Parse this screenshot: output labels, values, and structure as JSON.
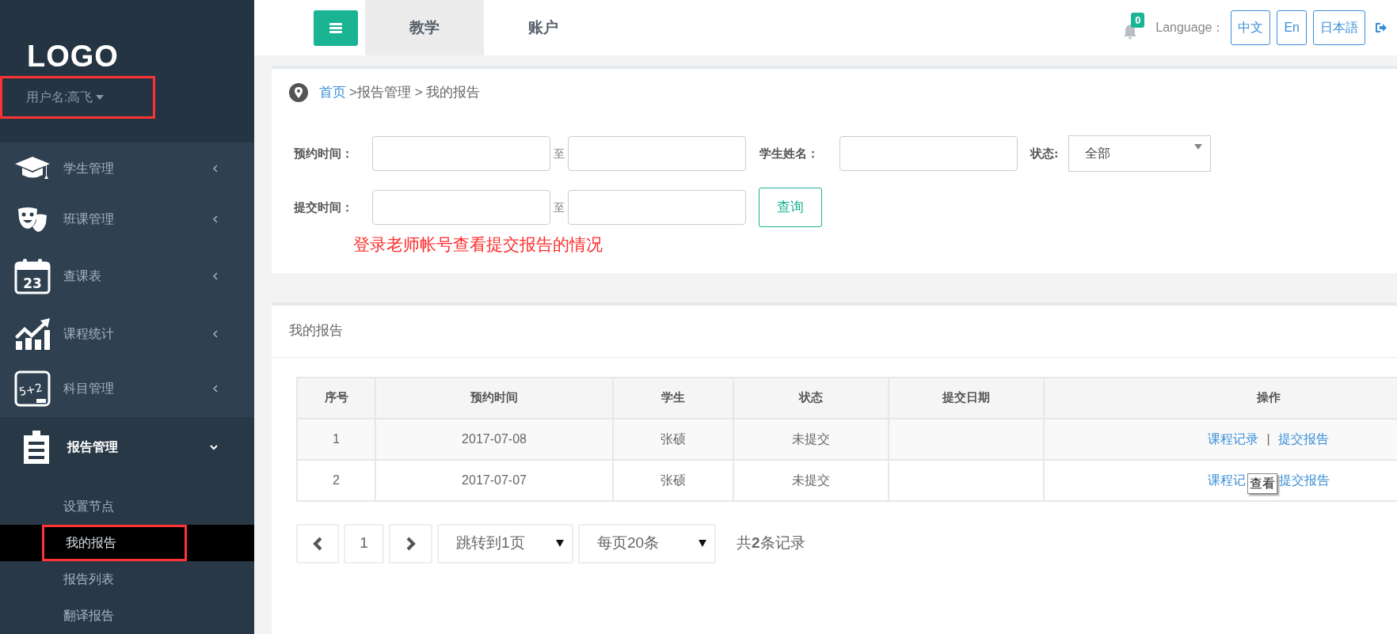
{
  "sidebar": {
    "logo": "LOGO",
    "user": "用户名:高飞",
    "user_annotated": true,
    "items": [
      {
        "label": "学生管理",
        "expanded": false
      },
      {
        "label": "班课管理",
        "expanded": false
      },
      {
        "label": "查课表",
        "expanded": false,
        "icon_text": "23"
      },
      {
        "label": "课程统计",
        "expanded": false
      },
      {
        "label": "科目管理",
        "expanded": false,
        "icon_text": "5+2"
      },
      {
        "label": "报告管理",
        "expanded": true,
        "children": [
          {
            "label": "设置节点",
            "selected": false,
            "annotated": false
          },
          {
            "label": "我的报告",
            "selected": true,
            "annotated": true
          },
          {
            "label": "报告列表",
            "selected": false,
            "annotated": false
          },
          {
            "label": "翻译报告",
            "selected": false,
            "annotated": false
          }
        ]
      }
    ]
  },
  "topbar": {
    "tabs": [
      {
        "label": "教学",
        "selected": true
      },
      {
        "label": "账户",
        "selected": false
      }
    ],
    "notifications": "0",
    "language_label": "Language：",
    "languages": [
      "中文",
      "En",
      "日本語"
    ]
  },
  "breadcrumb": {
    "home": "首页",
    "rest": ">报告管理 > 我的报告"
  },
  "filters": {
    "rows": [
      [
        {
          "kind": "range",
          "label": "预约时间：",
          "separator": "至"
        },
        {
          "kind": "text",
          "label": "学生姓名："
        },
        {
          "kind": "select",
          "label": "状态:",
          "value": "全部"
        }
      ],
      [
        {
          "kind": "range",
          "label": "提交时间：",
          "separator": "至"
        },
        {
          "kind": "button",
          "label": "查询"
        }
      ]
    ],
    "annotation": "登录老师帐号查看提交报告的情况"
  },
  "report_panel": {
    "title": "我的报告",
    "table": {
      "columns": [
        "序号",
        "预约时间",
        "学生",
        "状态",
        "提交日期",
        "操作"
      ],
      "rows": [
        {
          "cells": [
            "1",
            "2017-07-08",
            "张硕",
            "未提交",
            ""
          ],
          "actions": [
            "课程记录",
            "提交报告"
          ],
          "separator": "|"
        },
        {
          "cells": [
            "2",
            "2017-07-07",
            "张硕",
            "未提交",
            ""
          ],
          "actions": [
            "课程记",
            "提交报告"
          ],
          "tooltip": "查看"
        }
      ]
    },
    "pagination": {
      "page": "1",
      "jump": "跳转到1页",
      "per_page": "每页20条",
      "total": "共**2**条记录"
    }
  }
}
